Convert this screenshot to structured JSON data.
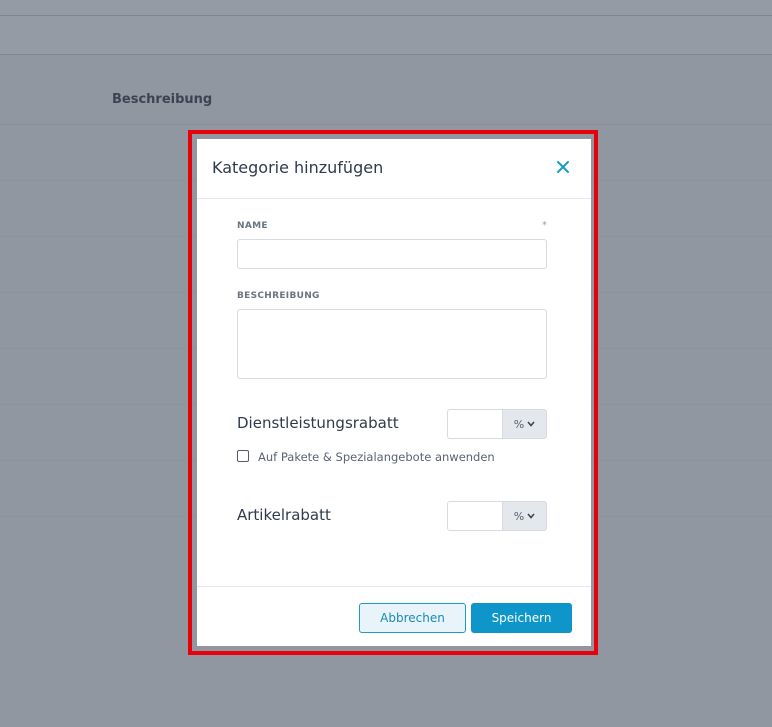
{
  "background": {
    "column_title": "Beschreibung"
  },
  "modal": {
    "title": "Kategorie hinzufügen",
    "close_icon": "close-icon",
    "fields": {
      "name_label": "NAME",
      "required_marker": "*",
      "name_value": "",
      "description_label": "BESCHREIBUNG",
      "description_value": ""
    },
    "service_discount": {
      "label": "Dienstleistungsrabatt",
      "value": "",
      "unit": "%"
    },
    "apply_packages": {
      "label": "Auf Pakete & Spezialangebote anwenden",
      "checked": false
    },
    "article_discount": {
      "label": "Artikelrabatt",
      "value": "",
      "unit": "%"
    },
    "buttons": {
      "cancel": "Abbrechen",
      "save": "Speichern"
    }
  },
  "colors": {
    "accent": "#0e96cb",
    "highlight": "#e8000b",
    "overlay": "#9097a1"
  }
}
